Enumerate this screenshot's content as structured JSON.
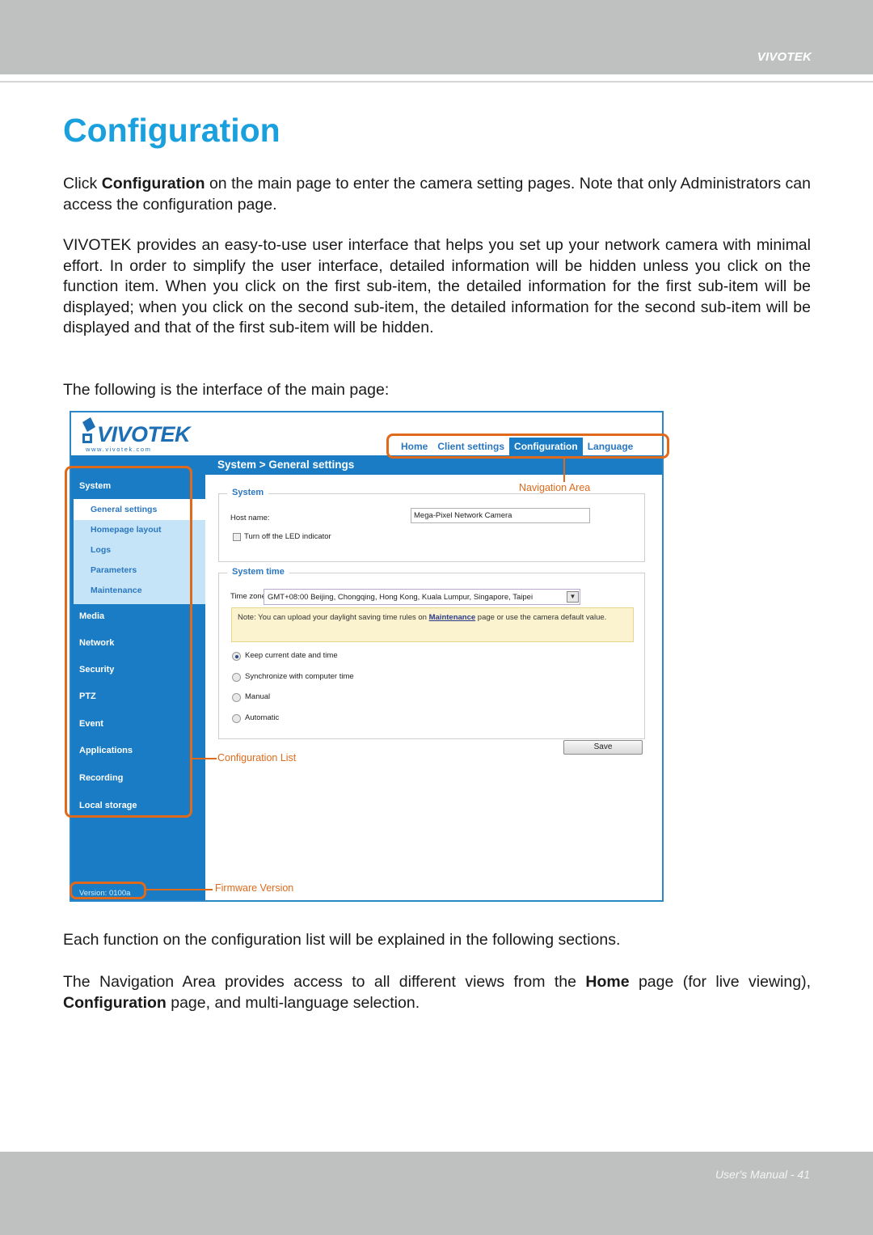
{
  "header": {
    "brand": "VIVOTEK"
  },
  "title": "Configuration",
  "paragraphs": {
    "p1": {
      "pre": "Click ",
      "bold": "Configuration",
      "post": " on the main page to enter the camera setting pages. Note that only Administrators can access the configuration page."
    },
    "p2": "VIVOTEK provides an easy-to-use user interface that helps you set up your network camera with minimal effort. In order to simplify the user interface, detailed information will be hidden unless you click on the function item. When you click on the first sub-item, the detailed information for the first sub-item will be displayed; when you click on the second sub-item, the detailed information for the second sub-item will be displayed and that of the first sub-item will be hidden.",
    "p3": "The following is the interface of the main page:",
    "p4": "Each function on the configuration list will be explained in the following sections.",
    "p5": {
      "pre": "The Navigation Area provides access to all different views from the ",
      "bold1": "Home",
      "mid": " page (for live viewing), ",
      "bold2": "Configuration",
      "post": " page, and multi-language selection."
    }
  },
  "screenshot": {
    "logo": {
      "word": "VIVOTEK",
      "url": "www.vivotek.com"
    },
    "nav_tabs": [
      {
        "label": "Home",
        "active": false
      },
      {
        "label": "Client settings",
        "active": false
      },
      {
        "label": "Configuration",
        "active": true
      },
      {
        "label": "Language",
        "active": false
      }
    ],
    "breadcrumb": "System  > General settings",
    "sidebar": {
      "top": "System",
      "sub_items": [
        "General settings",
        "Homepage layout",
        "Logs",
        "Parameters",
        "Maintenance"
      ],
      "items": [
        "Media",
        "Network",
        "Security",
        "PTZ",
        "Event",
        "Applications",
        "Recording",
        "Local storage"
      ],
      "version": "Version: 0100a"
    },
    "system_section": {
      "legend": "System",
      "host_label": "Host name:",
      "host_value": "Mega-Pixel Network Camera",
      "led_label": "Turn off the LED indicator",
      "led_checked": false
    },
    "time_section": {
      "legend": "System time",
      "tz_label": "Time zone:",
      "tz_value": "GMT+08:00 Beijing, Chongqing, Hong Kong, Kuala Lumpur, Singapore, Taipei",
      "note_pre": "Note: You can upload your daylight saving time rules on ",
      "note_link": "Maintenance",
      "note_post": " page or use the camera default value.",
      "options": [
        {
          "label": "Keep current date and time",
          "selected": true
        },
        {
          "label": "Synchronize with computer time",
          "selected": false
        },
        {
          "label": "Manual",
          "selected": false
        },
        {
          "label": "Automatic",
          "selected": false
        }
      ]
    },
    "save_label": "Save",
    "annotations": {
      "navigation_area": "Navigation Area",
      "configuration_list": "Configuration List",
      "firmware_version": "Firmware Version"
    },
    "colors": {
      "accent": "#1a7cc4",
      "annotation": "#e06a1b",
      "title": "#1ba0de"
    }
  },
  "footer": {
    "page_label": "User's Manual - 41"
  }
}
